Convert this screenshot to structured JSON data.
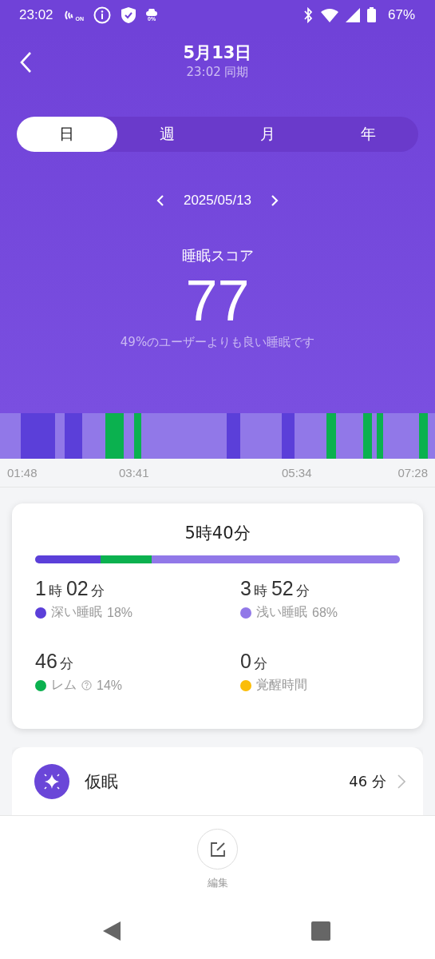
{
  "status_bar": {
    "time": "23:02",
    "nfc_label": "ON",
    "data_label": "0%",
    "battery": "67%"
  },
  "header": {
    "title": "5月13日",
    "subtitle": "23:02 同期"
  },
  "tabs": [
    {
      "label": "日",
      "selected": true
    },
    {
      "label": "週",
      "selected": false
    },
    {
      "label": "月",
      "selected": false
    },
    {
      "label": "年",
      "selected": false
    }
  ],
  "date_nav": {
    "date": "2025/05/13"
  },
  "score": {
    "label": "睡眠スコア",
    "value": "77",
    "comparison": "49%のユーザーよりも良い睡眠です"
  },
  "timeline": {
    "ticks": [
      "01:48",
      "03:41",
      "05:34",
      "07:28"
    ]
  },
  "summary": {
    "total": "5時40分",
    "stages": [
      {
        "kind": "deep",
        "parts": [
          {
            "n": "1",
            "unit": "時"
          },
          {
            "n": "02",
            "unit": "分"
          }
        ],
        "name": "深い睡眠",
        "percent": "18%",
        "color": "#5b3fd9"
      },
      {
        "kind": "light",
        "parts": [
          {
            "n": "3",
            "unit": "時"
          },
          {
            "n": "52",
            "unit": "分"
          }
        ],
        "name": "浅い睡眠",
        "percent": "68%",
        "color": "#9178e8"
      },
      {
        "kind": "rem",
        "parts": [
          {
            "n": "46",
            "unit": "分"
          }
        ],
        "name": "レム",
        "percent": "14%",
        "color": "#0bb14f",
        "help": true
      },
      {
        "kind": "awake",
        "parts": [
          {
            "n": "0",
            "unit": "分"
          }
        ],
        "name": "覚醒時間",
        "color": "#fbbd08"
      }
    ]
  },
  "nap": {
    "label": "仮眠",
    "value": "46 分"
  },
  "bottom": {
    "edit_label": "編集"
  }
}
